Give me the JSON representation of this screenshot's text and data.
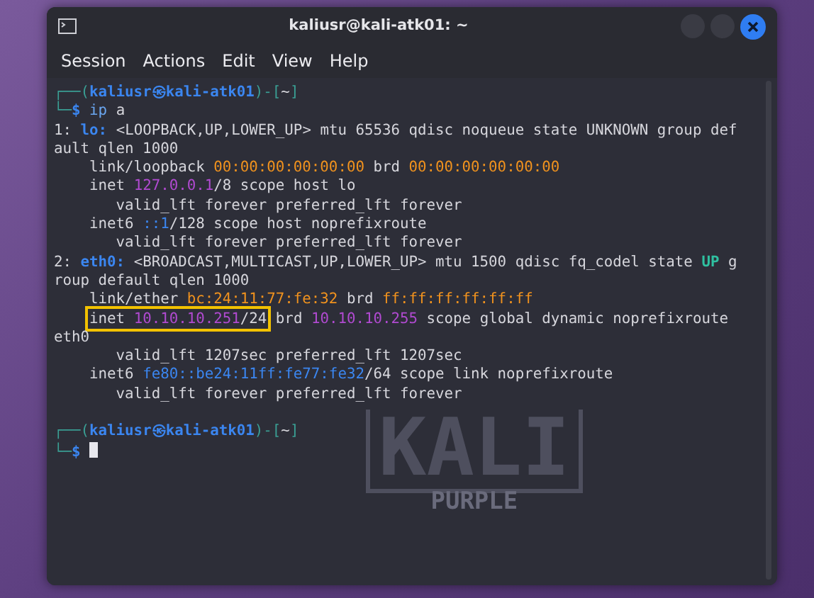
{
  "window": {
    "title": "kaliusr@kali-atk01: ~"
  },
  "menu": [
    "Session",
    "Actions",
    "Edit",
    "View",
    "Help"
  ],
  "background_logo": {
    "title": "KALI",
    "subtitle": "PURPLE"
  },
  "terminal_lines": [
    {
      "segments": [
        {
          "text": "┌──(",
          "kind": "frame"
        },
        {
          "text": "kaliusr㉿kali-atk01",
          "kind": "user"
        },
        {
          "text": ")-[",
          "kind": "frame"
        },
        {
          "text": "~",
          "kind": "plain"
        },
        {
          "text": "]",
          "kind": "frame"
        }
      ]
    },
    {
      "segments": [
        {
          "text": "└─",
          "kind": "frame"
        },
        {
          "text": "$",
          "kind": "user"
        },
        {
          "text": " ip",
          "kind": "command"
        },
        {
          "text": " a",
          "kind": "plain"
        }
      ]
    },
    {
      "segments": [
        {
          "text": "1: ",
          "kind": "plain"
        },
        {
          "text": "lo:",
          "kind": "iface"
        },
        {
          "text": " <LOOPBACK,UP,LOWER_UP> mtu 65536 qdisc noqueue state UNKNOWN group def",
          "kind": "plain"
        }
      ]
    },
    {
      "segments": [
        {
          "text": "ault qlen 1000",
          "kind": "plain"
        }
      ]
    },
    {
      "segments": [
        {
          "text": "    link/loopback ",
          "kind": "plain"
        },
        {
          "text": "00:00:00:00:00:00",
          "kind": "mac"
        },
        {
          "text": " brd ",
          "kind": "plain"
        },
        {
          "text": "00:00:00:00:00:00",
          "kind": "mac"
        }
      ]
    },
    {
      "segments": [
        {
          "text": "    inet ",
          "kind": "plain"
        },
        {
          "text": "127.0.0.1",
          "kind": "ipv4"
        },
        {
          "text": "/8 scope host lo",
          "kind": "plain"
        }
      ]
    },
    {
      "segments": [
        {
          "text": "       valid_lft forever preferred_lft forever",
          "kind": "plain"
        }
      ]
    },
    {
      "segments": [
        {
          "text": "    inet6 ",
          "kind": "plain"
        },
        {
          "text": "::1",
          "kind": "ipv6"
        },
        {
          "text": "/128 scope host noprefixroute",
          "kind": "plain"
        }
      ]
    },
    {
      "segments": [
        {
          "text": "       valid_lft forever preferred_lft forever",
          "kind": "plain"
        }
      ]
    },
    {
      "segments": [
        {
          "text": "2: ",
          "kind": "plain"
        },
        {
          "text": "eth0:",
          "kind": "iface"
        },
        {
          "text": " <BROADCAST,MULTICAST,UP,LOWER_UP> mtu 1500 qdisc fq_codel state ",
          "kind": "plain"
        },
        {
          "text": "UP",
          "kind": "up"
        },
        {
          "text": " g",
          "kind": "plain"
        }
      ]
    },
    {
      "segments": [
        {
          "text": "roup default qlen 1000",
          "kind": "plain"
        }
      ]
    },
    {
      "segments": [
        {
          "text": "    link/ether ",
          "kind": "plain"
        },
        {
          "text": "bc:24:11:77:fe:32",
          "kind": "mac"
        },
        {
          "text": " brd ",
          "kind": "plain"
        },
        {
          "text": "ff:ff:ff:ff:ff:ff",
          "kind": "mac"
        }
      ]
    },
    {
      "segments": [
        {
          "text": "    inet ",
          "kind": "plain",
          "highlighted": true
        },
        {
          "text": "10.10.10.251",
          "kind": "ipv4",
          "highlighted": true
        },
        {
          "text": "/24",
          "kind": "plain",
          "highlighted": true
        },
        {
          "text": " brd ",
          "kind": "plain"
        },
        {
          "text": "10.10.10.255",
          "kind": "ipv4"
        },
        {
          "text": " scope global dynamic noprefixroute",
          "kind": "plain"
        }
      ]
    },
    {
      "segments": [
        {
          "text": "eth0",
          "kind": "plain"
        }
      ]
    },
    {
      "segments": [
        {
          "text": "       valid_lft 1207sec preferred_lft 1207sec",
          "kind": "plain"
        }
      ]
    },
    {
      "segments": [
        {
          "text": "    inet6 ",
          "kind": "plain"
        },
        {
          "text": "fe80::be24:11ff:fe77:fe32",
          "kind": "ipv6"
        },
        {
          "text": "/64 scope link noprefixroute",
          "kind": "plain"
        }
      ]
    },
    {
      "segments": [
        {
          "text": "       valid_lft forever preferred_lft forever",
          "kind": "plain"
        }
      ]
    },
    {
      "gap_before": true,
      "segments": [
        {
          "text": "┌──(",
          "kind": "frame"
        },
        {
          "text": "kaliusr㉿kali-atk01",
          "kind": "user"
        },
        {
          "text": ")-[",
          "kind": "frame"
        },
        {
          "text": "~",
          "kind": "plain"
        },
        {
          "text": "]",
          "kind": "frame"
        }
      ]
    },
    {
      "cursor": true,
      "segments": [
        {
          "text": "└─",
          "kind": "frame"
        },
        {
          "text": "$",
          "kind": "user"
        }
      ]
    }
  ]
}
